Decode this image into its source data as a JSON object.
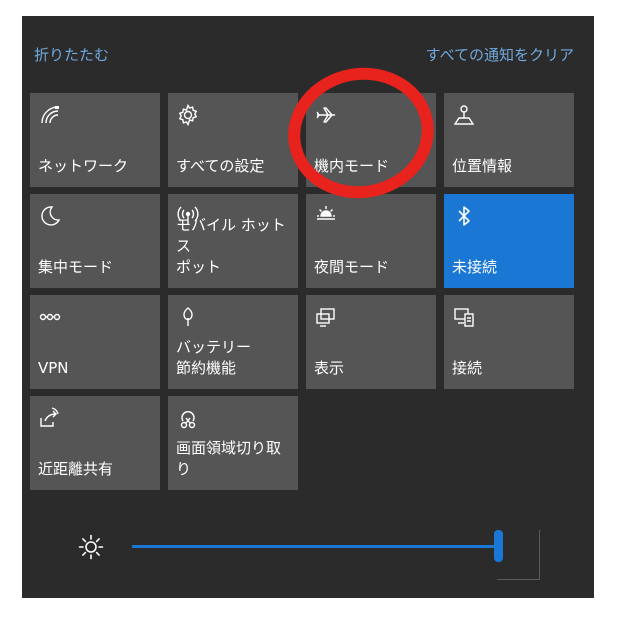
{
  "header": {
    "collapse_label": "折りたたむ",
    "clear_all_label": "すべての通知をクリア"
  },
  "tiles": [
    {
      "label": "ネットワーク",
      "icon": "network-icon",
      "active": false
    },
    {
      "label": "すべての設定",
      "icon": "gear-icon",
      "active": false
    },
    {
      "label": "機内モード",
      "icon": "airplane-icon",
      "active": false
    },
    {
      "label": "位置情報",
      "icon": "location-icon",
      "active": false
    },
    {
      "label": "集中モード",
      "icon": "moon-icon",
      "active": false
    },
    {
      "label": "モバイル ホットス\nポット",
      "icon": "hotspot-icon",
      "active": false
    },
    {
      "label": "夜間モード",
      "icon": "night-light-icon",
      "active": false
    },
    {
      "label": "未接続",
      "icon": "bluetooth-icon",
      "active": true
    },
    {
      "label": "VPN",
      "icon": "vpn-icon",
      "active": false
    },
    {
      "label": "バッテリー\n節約機能",
      "icon": "battery-saver-icon",
      "active": false
    },
    {
      "label": "表示",
      "icon": "project-icon",
      "active": false
    },
    {
      "label": "接続",
      "icon": "connect-icon",
      "active": false
    },
    {
      "label": "近距離共有",
      "icon": "nearby-share-icon",
      "active": false
    },
    {
      "label": "画面領域切り取\nり",
      "icon": "snip-icon",
      "active": false
    }
  ],
  "brightness": {
    "icon": "brightness-icon",
    "level": 1.0
  },
  "colors": {
    "panel_bg": "#2b2b2b",
    "tile_bg": "#555555",
    "accent": "#1a78d4",
    "link": "#6fa8dc",
    "highlight": "#e8221c"
  }
}
